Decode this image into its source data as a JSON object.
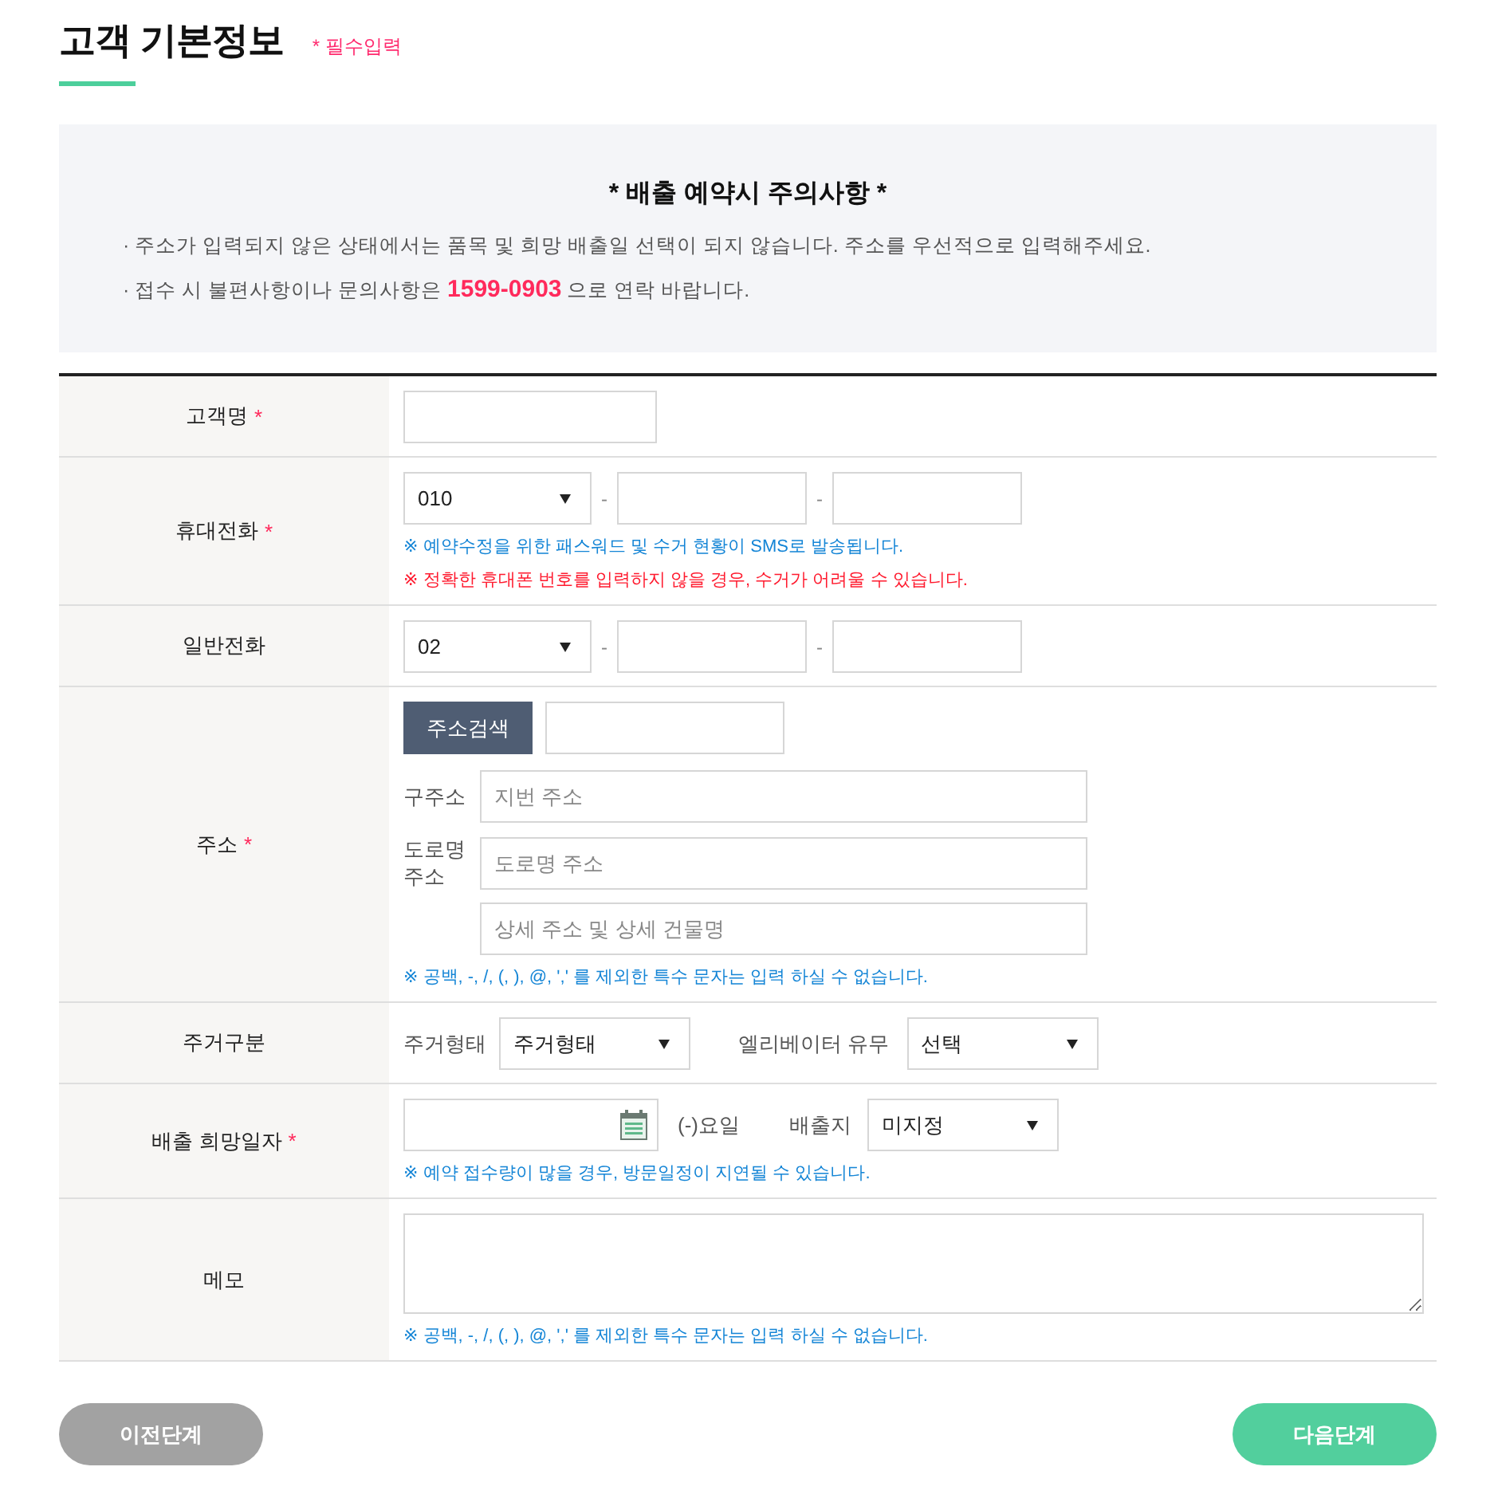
{
  "header": {
    "title": "고객 기본정보",
    "required_note": "* 필수입력"
  },
  "notice": {
    "title": "* 배출 예약시 주의사항 *",
    "items": [
      "· 주소가 입력되지 않은 상태에서는 품목 및 희망 배출일 선택이 되지 않습니다. 주소를 우선적으로 입력해주세요.",
      "· 접수 시 불편사항이나 문의사항은 **1599-0903** 으로 연락 바랍니다."
    ]
  },
  "form": {
    "rows": [
      {
        "label": "고객명",
        "required_mark": "*",
        "kind": "text"
      },
      {
        "label": "휴대전화",
        "required_mark": "*",
        "kind": "phone",
        "prefix": "010",
        "separators": [
          "-",
          "-"
        ],
        "notes": [
          {
            "text": "※ 예약수정을 위한 패스워드 및 수거 현황이 SMS로 발송됩니다.",
            "kind": "info"
          },
          {
            "text": "※ 정확한 휴대폰 번호를 입력하지 않을 경우, 수거가 어려울 수 있습니다.",
            "kind": "warning"
          }
        ]
      },
      {
        "label": "일반전화",
        "kind": "phone",
        "prefix": "02",
        "separators": [
          "-",
          "-"
        ]
      },
      {
        "label": "주소",
        "required_mark": "*",
        "kind": "address",
        "search_button": "주소검색",
        "fields": [
          {
            "label": "구주소",
            "placeholder": "지번 주소"
          },
          {
            "label": "도로명 주소",
            "placeholder": "도로명 주소"
          },
          {
            "placeholder": "상세 주소 및 상세 건물명"
          }
        ],
        "notes": [
          {
            "text": "※ 공백, -, /, (, ), @, ',' 를 제외한 특수 문자는 입력 하실 수 없습니다.",
            "kind": "info"
          }
        ]
      },
      {
        "label": "주거구분",
        "kind": "housing",
        "selects": [
          {
            "label": "주거형태",
            "value": "주거형태"
          },
          {
            "label": "엘리베이터 유무",
            "value": "선택"
          }
        ]
      },
      {
        "label": "배출 희망일자",
        "required_mark": "*",
        "kind": "date",
        "weekday": "(-)요일",
        "place_label": "배출지",
        "place_value": "미지정",
        "notes": [
          {
            "text": "※ 예약 접수량이 많을 경우, 방문일정이 지연될 수 있습니다.",
            "kind": "info"
          }
        ]
      },
      {
        "label": "메모",
        "kind": "memo",
        "notes": [
          {
            "text": "※ 공백, -, /, (, ), @, ',' 를 제외한 특수 문자는 입력 하실 수 없습니다.",
            "kind": "info"
          }
        ]
      }
    ]
  },
  "buttons": [
    {
      "label": "이전단계",
      "kind": "secondary"
    },
    {
      "label": "다음단계",
      "kind": "primary"
    }
  ]
}
